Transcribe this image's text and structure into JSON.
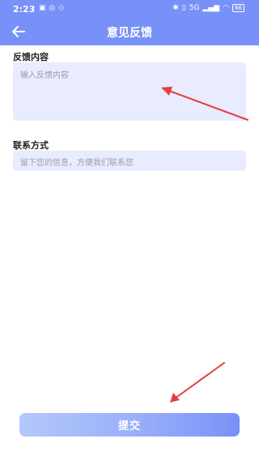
{
  "status_bar": {
    "time": "2:23",
    "left_icons": [
      "app-notification-icon",
      "app-notification-icon",
      "app-notification-icon"
    ],
    "right_icons": [
      "bluetooth-icon",
      "vibrate-icon",
      "network-icon",
      "signal-icon",
      "wifi-icon"
    ],
    "network_label": "5G",
    "battery_label": "66"
  },
  "header": {
    "back_icon": "arrow-left-icon",
    "title": "意见反馈"
  },
  "form": {
    "feedback_label": "反馈内容",
    "feedback_placeholder": "输入反馈内容",
    "contact_label": "联系方式",
    "contact_placeholder": "留下您的信息，方便我们联系您"
  },
  "submit": {
    "label": "提交"
  },
  "colors": {
    "header_bg": "#7891f8",
    "input_bg": "#e9ecff",
    "annotation_arrow": "#e04040"
  }
}
